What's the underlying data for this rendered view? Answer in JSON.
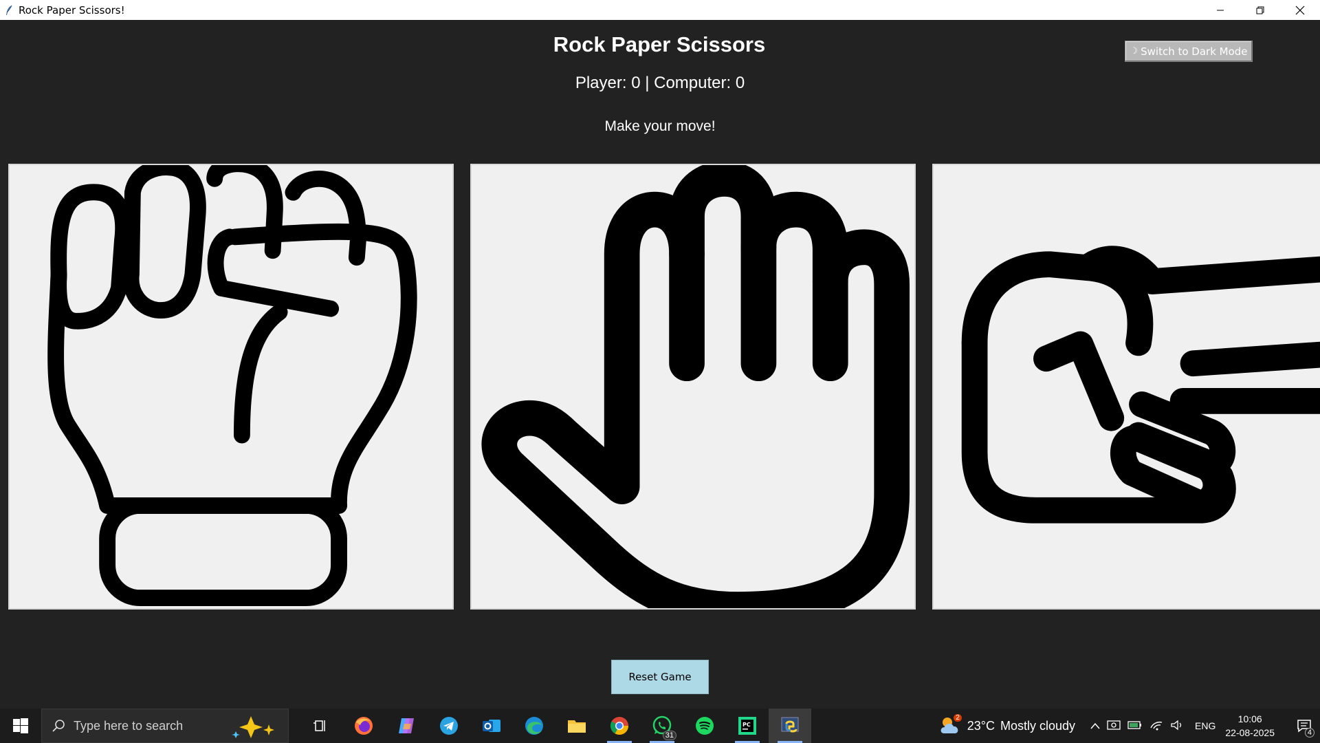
{
  "window": {
    "title": "Rock Paper Scissors!"
  },
  "app": {
    "heading": "Rock Paper Scissors",
    "score": "Player: 0 | Computer: 0",
    "status": "Make your move!",
    "mode_button": "Switch to Dark Mode",
    "reset_button": "Reset Game",
    "choices": [
      {
        "name": "rock",
        "icon": "fist-icon"
      },
      {
        "name": "paper",
        "icon": "open-hand-icon"
      },
      {
        "name": "scissors",
        "icon": "victory-hand-icon"
      }
    ]
  },
  "taskbar": {
    "search_placeholder": "Type here to search",
    "apps": [
      "task-view",
      "firefox",
      "copilot",
      "telegram",
      "outlook",
      "edge",
      "file-explorer",
      "chrome",
      "whatsapp",
      "spotify",
      "pycharm",
      "python"
    ],
    "whatsapp_badge": "31",
    "weather_badge": "2",
    "weather_temp": "23°C",
    "weather_desc": "Mostly cloudy",
    "language": "ENG",
    "time": "10:06",
    "date": "22-08-2025",
    "notification_count": "4"
  },
  "colors": {
    "background": "#222222",
    "choice_bg": "#f0f0f0",
    "reset_button_bg": "#add8e6",
    "mode_button_bg": "#b8b8b8"
  }
}
